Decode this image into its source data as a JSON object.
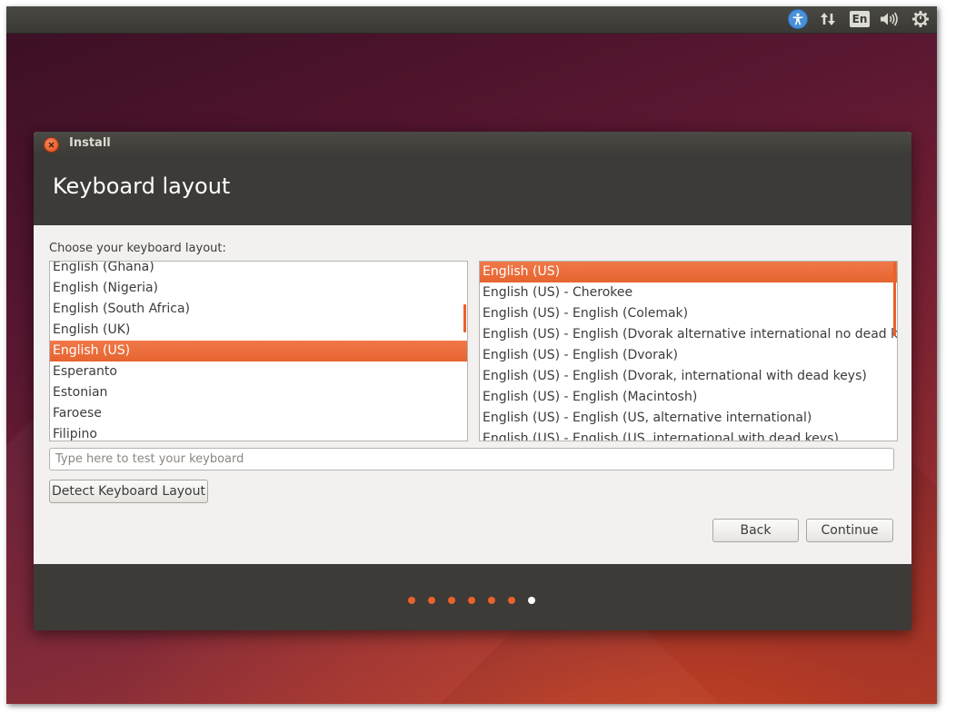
{
  "panel": {
    "language_indicator": "En",
    "icons": [
      "accessibility-icon",
      "network-icon",
      "language-indicator",
      "sound-icon",
      "power-gear-icon"
    ]
  },
  "window": {
    "title": "Install",
    "page_title": "Keyboard layout",
    "prompt": "Choose your keyboard layout:"
  },
  "layouts": [
    "English (Ghana)",
    "English (Nigeria)",
    "English (South Africa)",
    "English (UK)",
    "English (US)",
    "Esperanto",
    "Estonian",
    "Faroese",
    "Filipino"
  ],
  "selected_layout": "English (US)",
  "variants": [
    "English (US)",
    "English (US) - Cherokee",
    "English (US) - English (Colemak)",
    "English (US) - English (Dvorak alternative international no dead keys)",
    "English (US) - English (Dvorak)",
    "English (US) - English (Dvorak, international with dead keys)",
    "English (US) - English (Macintosh)",
    "English (US) - English (US, alternative international)",
    "English (US) - English (US, international with dead keys)"
  ],
  "selected_variant": "English (US)",
  "test_input": {
    "placeholder": "Type here to test your keyboard",
    "value": ""
  },
  "buttons": {
    "detect": "Detect Keyboard Layout",
    "back": "Back",
    "continue": "Continue"
  },
  "progress": {
    "total_steps": 7,
    "current_step": 7
  },
  "colors": {
    "accent": "#e9622b",
    "header": "#3c3b37",
    "window_bg": "#f2f1f0"
  }
}
